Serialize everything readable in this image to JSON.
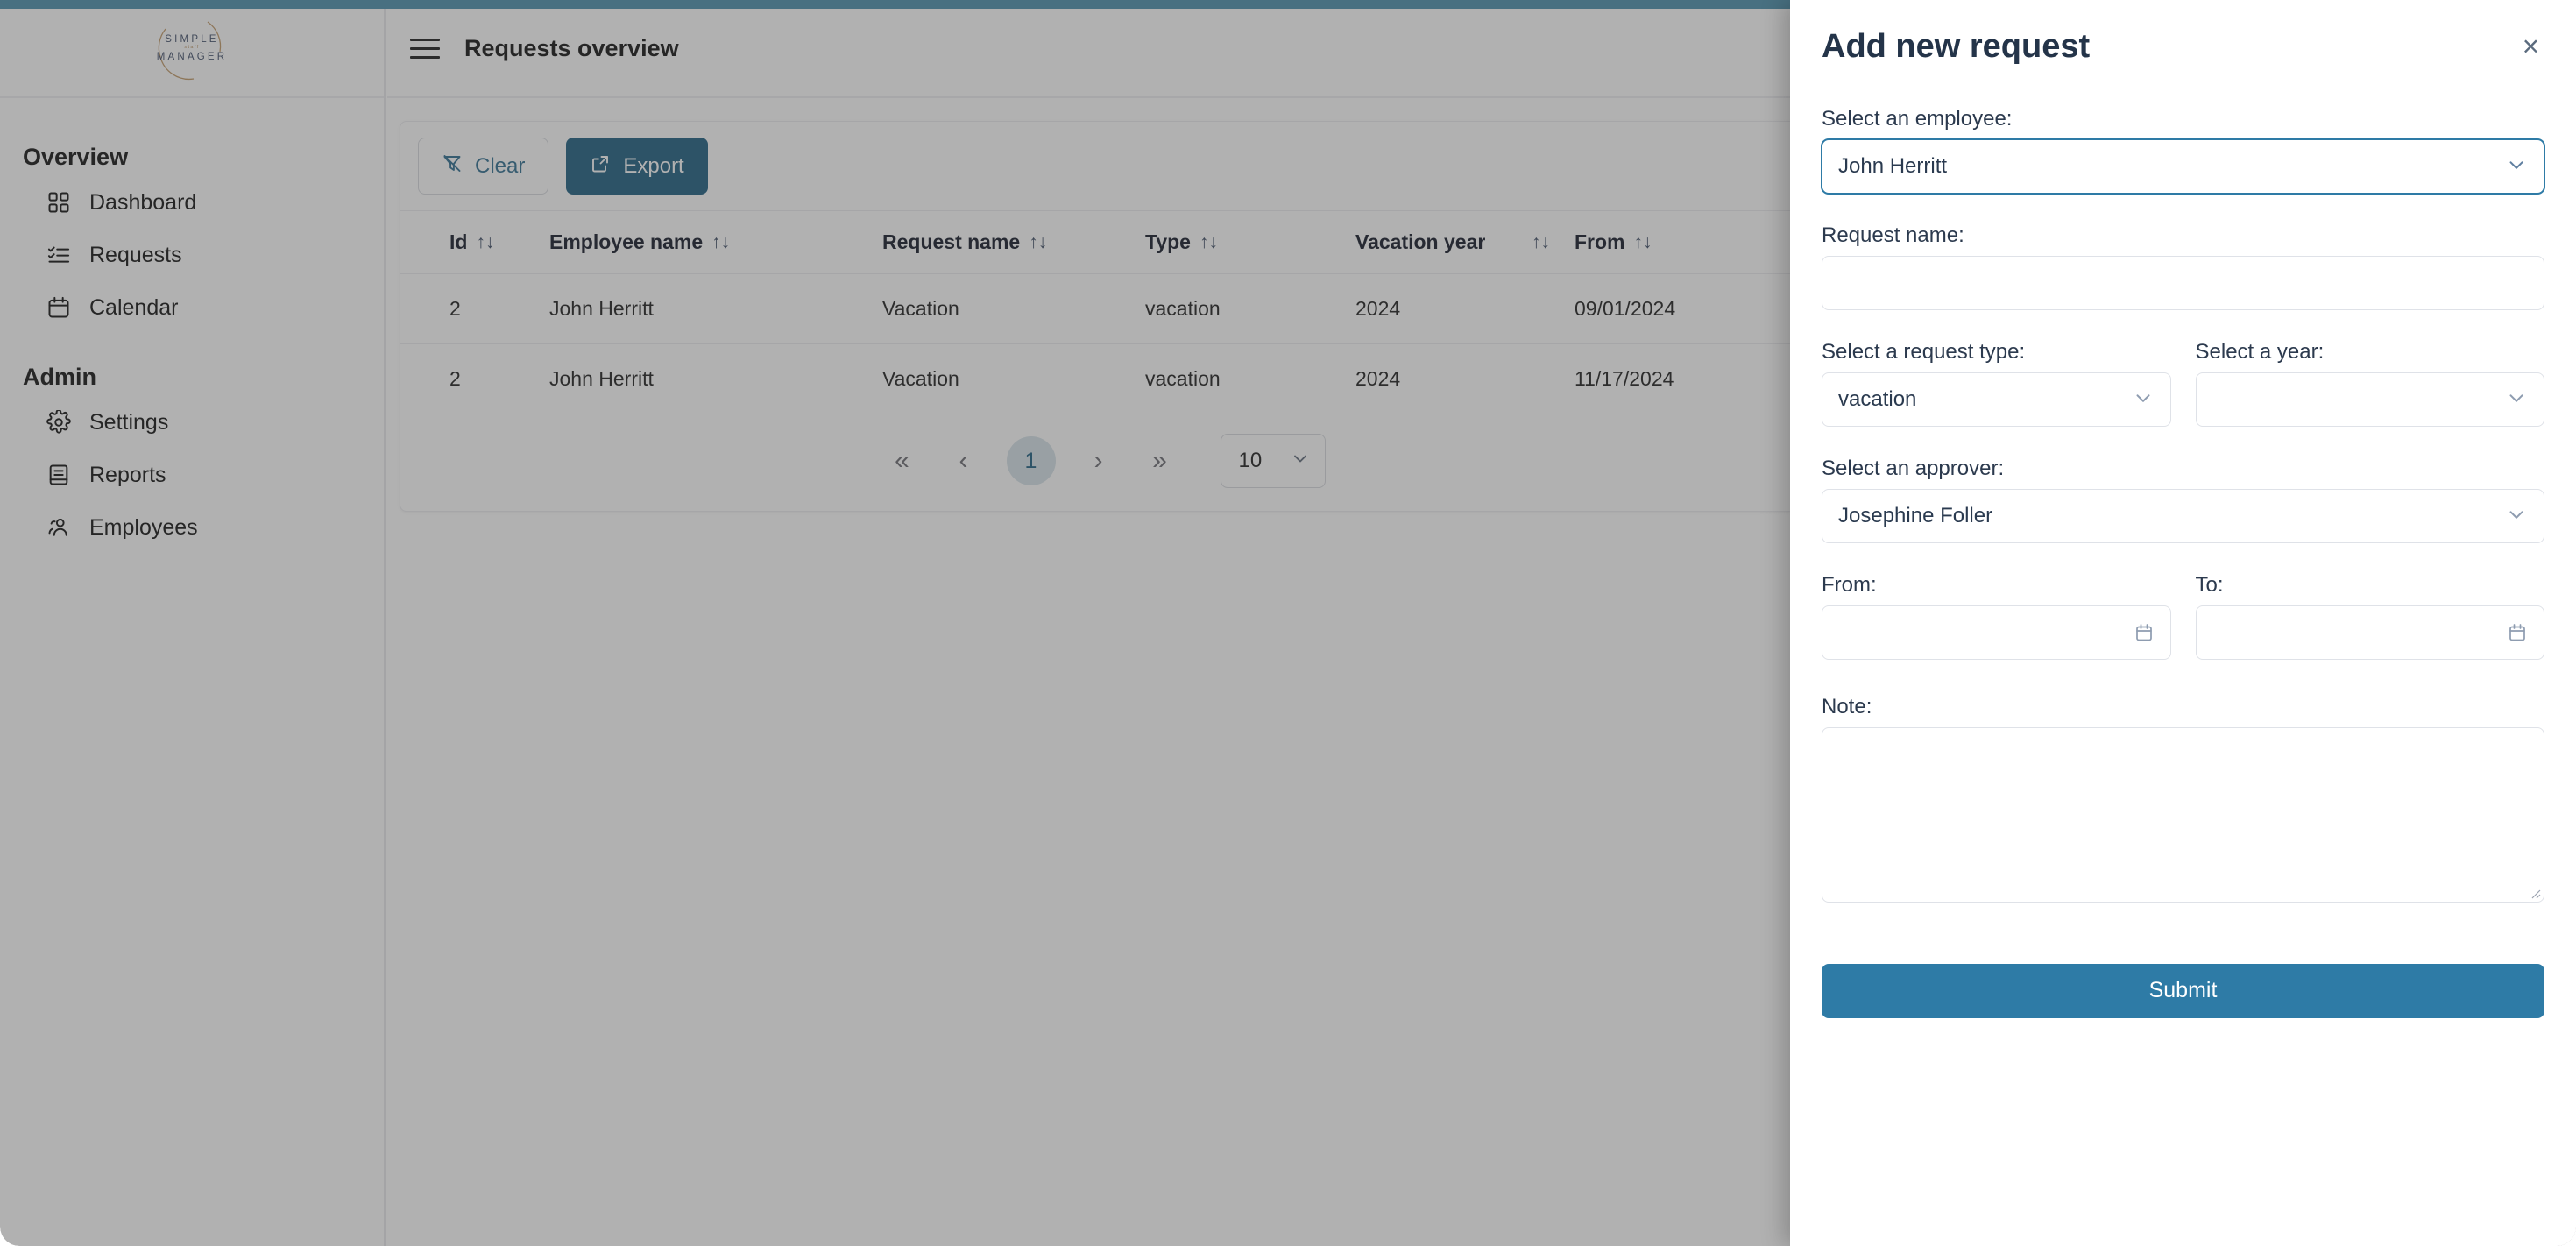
{
  "theme": {
    "accent_bar": "#4a90ac",
    "primary": "#1c5e80",
    "submit": "#2e7ba6",
    "focus_border": "#2e7ba6"
  },
  "brand": {
    "line1": "SIMPLE",
    "line2": "staff",
    "line3": "MANAGER"
  },
  "sidebar": {
    "groups": [
      {
        "title": "Overview",
        "items": [
          {
            "label": "Dashboard",
            "icon": "grid-icon"
          },
          {
            "label": "Requests",
            "icon": "checklist-icon"
          },
          {
            "label": "Calendar",
            "icon": "calendar-icon"
          }
        ]
      },
      {
        "title": "Admin",
        "items": [
          {
            "label": "Settings",
            "icon": "gear-icon"
          },
          {
            "label": "Reports",
            "icon": "book-icon"
          },
          {
            "label": "Employees",
            "icon": "people-icon"
          }
        ]
      }
    ]
  },
  "header": {
    "menu_icon": "hamburger-icon",
    "title": "Requests overview"
  },
  "toolbar": {
    "clear_label": "Clear",
    "clear_icon": "filter-off-icon",
    "export_label": "Export",
    "export_icon": "external-link-icon"
  },
  "table": {
    "sort_glyph": "↑↓",
    "columns": [
      {
        "label": "Id"
      },
      {
        "label": "Employee name"
      },
      {
        "label": "Request name"
      },
      {
        "label": "Type"
      },
      {
        "label": "Vacation year"
      },
      {
        "label": "From"
      }
    ],
    "rows": [
      {
        "id": "2",
        "employee_name": "John Herritt",
        "request_name": "Vacation",
        "type": "vacation",
        "vacation_year": "2024",
        "from": "09/01/2024"
      },
      {
        "id": "2",
        "employee_name": "John Herritt",
        "request_name": "Vacation",
        "type": "vacation",
        "vacation_year": "2024",
        "from": "11/17/2024"
      }
    ]
  },
  "pagination": {
    "first": "«",
    "prev": "‹",
    "current_page": "1",
    "next": "›",
    "last": "»",
    "page_size": "10",
    "page_size_chevron": "⌄"
  },
  "panel": {
    "title": "Add new request",
    "close_label": "×",
    "employee": {
      "label": "Select an employee:",
      "value": "John Herritt",
      "chevron": "⌄"
    },
    "request_name": {
      "label": "Request name:",
      "value": "",
      "placeholder": ""
    },
    "request_type": {
      "label": "Select a request type:",
      "value": "vacation",
      "chevron": "⌄"
    },
    "year": {
      "label": "Select a year:",
      "value": "",
      "chevron": "⌄"
    },
    "approver": {
      "label": "Select an approver:",
      "value": "Josephine Foller",
      "chevron": "⌄"
    },
    "from": {
      "label": "From:",
      "value": "",
      "icon": "calendar-icon"
    },
    "to": {
      "label": "To:",
      "value": "",
      "icon": "calendar-icon"
    },
    "note": {
      "label": "Note:",
      "value": "",
      "placeholder": ""
    },
    "submit_label": "Submit"
  }
}
